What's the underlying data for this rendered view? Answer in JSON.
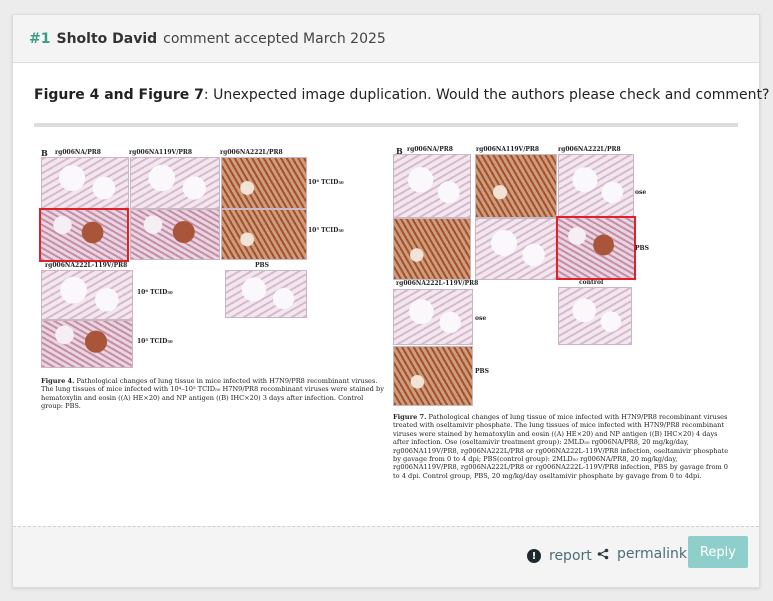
{
  "header": {
    "number": "#1",
    "author": "Sholto David",
    "status": "comment accepted March 2025"
  },
  "comment": {
    "bold_prefix": "Figure 4 and Figure 7",
    "text": ": Unexpected image duplication. Would the authors please check and comment?"
  },
  "figure_left": {
    "panel": "B",
    "col_labels": [
      "rg006NA/PR8",
      "rg006NA119V/PR8",
      "rg006NA222L/PR8"
    ],
    "row2_label": "rg006NA222L-119V/PR8",
    "pbs_label": "PBS",
    "dose_labels": [
      "10⁶ TCID₅₀",
      "10⁵ TCID₅₀",
      "10⁶ TCID₅₀",
      "10⁵ TCID₅₀"
    ],
    "caption_bold": "Figure 4.",
    "caption": " Pathological changes of lung tissue in mice infected with H7N9/PR8 recombinant viruses. The lung tissues of mice infected with 10⁴–10⁵ TCID₅₀ H7N9/PR8 recombinant viruses were stained by hematoxylin and eosin ((A) HE×20) and NP antigen ((B) IHC×20) 3 days after infection. Control group: PBS."
  },
  "figure_right": {
    "panel": "B",
    "col_labels": [
      "rg006NA/PR8",
      "rg006NA119V/PR8",
      "rg006NA222L/PR8"
    ],
    "row2_label": "rg006NA222L-119V/PR8",
    "control_label": "control",
    "side_labels": [
      "ose",
      "PBS",
      "ose",
      "PBS"
    ],
    "caption_bold": "Figure 7.",
    "caption": " Pathological changes of lung tissue of mice infected with H7N9/PR8 recombinant viruses treated with oseltamivir phosphate. The lung tissues of mice infected with H7N9/PR8 recombinant viruses were stained by hematoxylin and eosin ((A) HE×20) and NP antigen ((B) IHC×20) 4 days after infection. Ose (oseltamivir treatment group): 2MLD₅₀ rg006NA/PR8, 20 mg/kg/day, rg006NA119V/PR8, rg006NA222L/PR8 or rg006NA222L-119V/PR8 infection, oseltamivir phosphate by gavage from 0 to 4 dpi; PBS(control group): 2MLD₅₀ rg006NA/PR8, 20 mg/kg/day, rg006NA119V/PR8, rg006NA222L/PR8 or rg006NA222L-119V/PR8 infection, PBS by gavage from 0 to 4 dpi. Control group, PBS, 20 mg/kg/day oseltamivir phosphate by gavage from 0 to 4dpi."
  },
  "footer": {
    "report_label": "report",
    "permalink_label": "permalink",
    "reply_label": "Reply"
  },
  "colors": {
    "accent": "#3a9d86",
    "link": "#4a6f78",
    "reply_button": "#8ecfcb",
    "highlight": "#e0202a"
  },
  "icons": {
    "report": "warning-circle-icon",
    "permalink": "share-icon"
  }
}
